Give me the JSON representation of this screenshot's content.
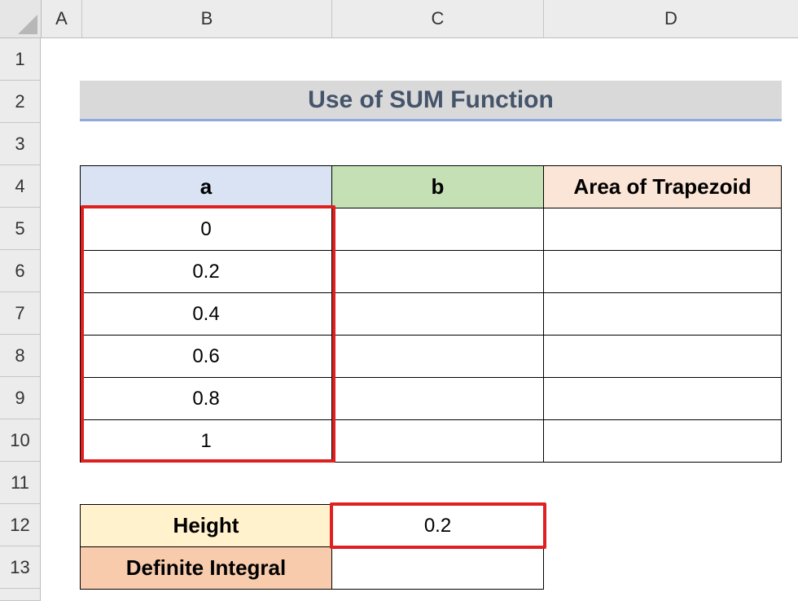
{
  "columns": [
    "A",
    "B",
    "C",
    "D"
  ],
  "rows": [
    "1",
    "2",
    "3",
    "4",
    "5",
    "6",
    "7",
    "8",
    "9",
    "10",
    "11",
    "12",
    "13"
  ],
  "title": "Use of SUM Function",
  "table": {
    "headers": [
      "a",
      "b",
      "Area of Trapezoid"
    ],
    "a_values": [
      "0",
      "0.2",
      "0.4",
      "0.6",
      "0.8",
      "1"
    ],
    "b_values": [
      "",
      "",
      "",
      "",
      "",
      ""
    ],
    "area_values": [
      "",
      "",
      "",
      "",
      "",
      ""
    ]
  },
  "summary": {
    "height_label": "Height",
    "height_value": "0.2",
    "integral_label": "Definite Integral",
    "integral_value": ""
  },
  "colors": {
    "highlight": "#e02020",
    "header_a": "#dae3f3",
    "header_b": "#c5e0b4",
    "header_area": "#fbe5d6",
    "height_label": "#fff2cc",
    "integral_label": "#f8cbad",
    "title_bg": "#d9d9d9",
    "title_text": "#44546a"
  }
}
